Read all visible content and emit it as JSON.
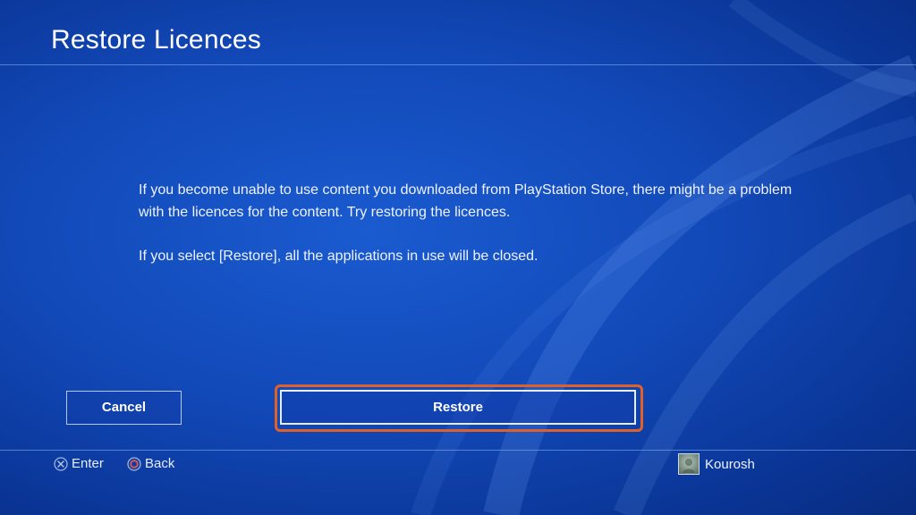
{
  "header": {
    "title": "Restore Licences"
  },
  "message": {
    "paragraph_1": "If you become unable to use content you downloaded from PlayStation Store, there might be a problem with the licences for the content. Try restoring the licences.",
    "paragraph_2": "If you select [Restore], all the applications in use will be closed."
  },
  "buttons": {
    "cancel_label": "Cancel",
    "restore_label": "Restore",
    "focused": "restore"
  },
  "footer": {
    "hints": [
      {
        "icon": "cross-button-icon",
        "label": "Enter"
      },
      {
        "icon": "circle-button-icon",
        "label": "Back"
      }
    ],
    "user": {
      "name": "Kourosh",
      "avatar_icon": "user-avatar"
    }
  },
  "colors": {
    "background": "#1249b8",
    "focus_ring": "#e0602a",
    "text": "#ffffff"
  }
}
